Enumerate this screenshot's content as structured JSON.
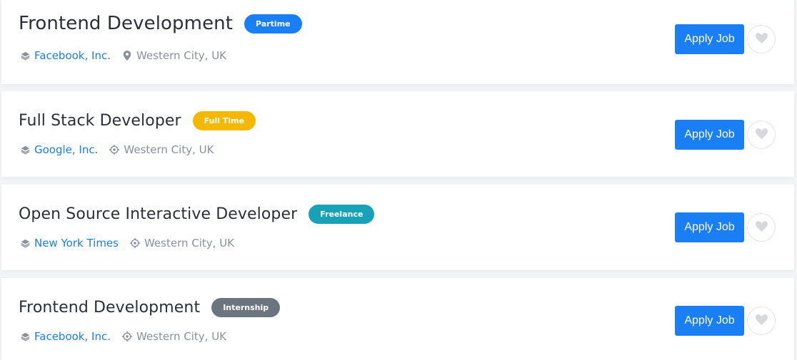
{
  "colors": {
    "primary": "#1a7ff5",
    "link": "#1a7df0",
    "muted": "#8a8f98",
    "heart": "#d6d8dc"
  },
  "jobs": [
    {
      "title": "Frontend Development",
      "type": "Partime",
      "type_color": "#1a7ff5",
      "type_text_color": "#ffffff",
      "company": "Facebook, Inc.",
      "company_icon": "layers-icon",
      "location": "Western City, UK",
      "location_icon": "map-pin-icon",
      "apply_label": "Apply Job",
      "favorite_icon": "heart-icon"
    },
    {
      "title": "Full Stack Developer",
      "type": "Full Time",
      "type_color": "#f5b800",
      "type_text_color": "#ffffff",
      "company": "Google, Inc.",
      "company_icon": "layers-icon",
      "location": "Western City, UK",
      "location_icon": "crosshair-icon",
      "apply_label": "Apply Job",
      "favorite_icon": "heart-icon"
    },
    {
      "title": "Open Source Interactive Developer",
      "type": "Freelance",
      "type_color": "#17a2b8",
      "type_text_color": "#ffffff",
      "company": "New York Times",
      "company_icon": "layers-icon",
      "location": "Western City, UK",
      "location_icon": "crosshair-icon",
      "apply_label": "Apply Job",
      "favorite_icon": "heart-icon"
    },
    {
      "title": "Frontend Development",
      "type": "Internship",
      "type_color": "#6c757d",
      "type_text_color": "#ffffff",
      "company": "Facebook, Inc.",
      "company_icon": "layers-icon",
      "location": "Western City, UK",
      "location_icon": "crosshair-icon",
      "apply_label": "Apply Job",
      "favorite_icon": "heart-icon"
    }
  ]
}
